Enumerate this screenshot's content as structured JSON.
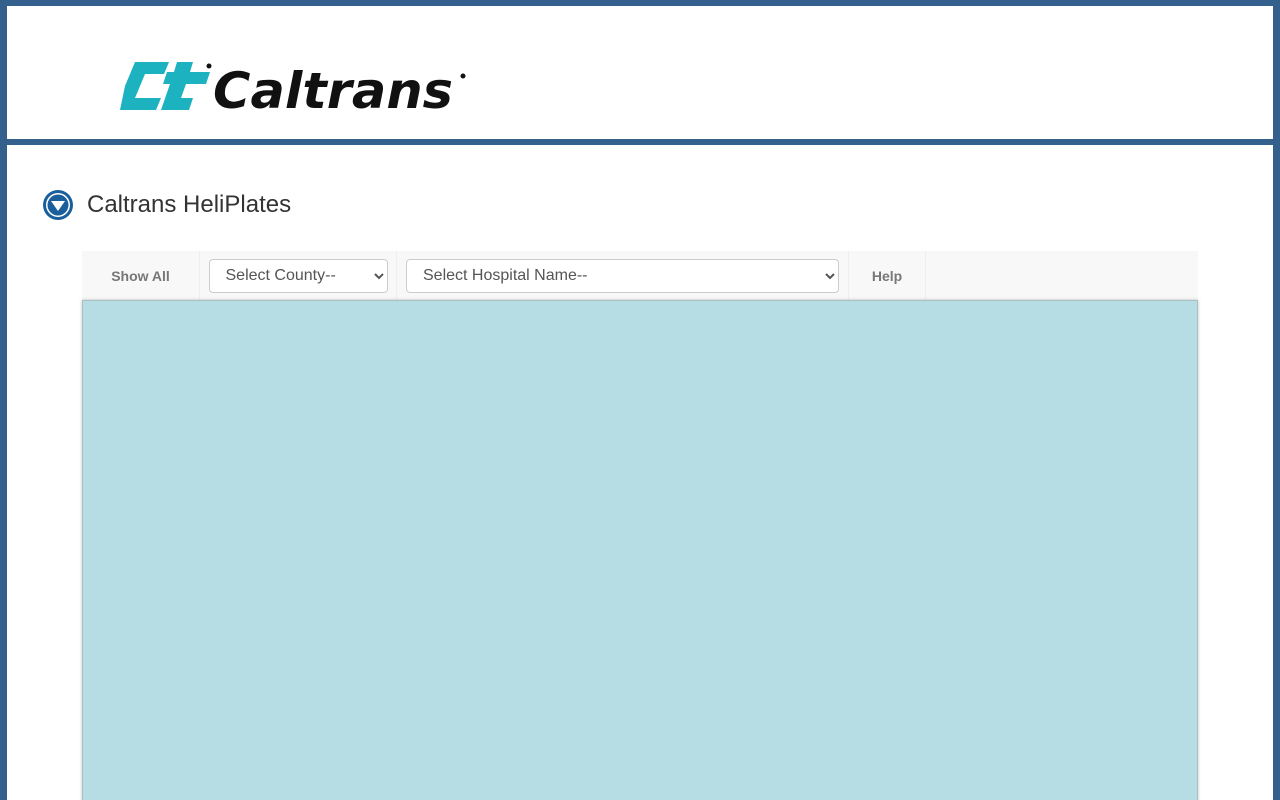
{
  "header": {
    "logo": {
      "icon": "caltrans-logo",
      "text": "Caltrans",
      "colors": {
        "mark": "#1cb2bf",
        "wordmark": "#111111"
      }
    }
  },
  "app": {
    "title": "Caltrans HeliPlates",
    "toggle_icon": "chevron-down-circle-icon"
  },
  "toolbar": {
    "show_all_label": "Show All",
    "county_select": {
      "selected": "Select County--",
      "options": [
        "Select County--"
      ]
    },
    "hospital_select": {
      "selected": "Select Hospital Name--",
      "options": [
        "Select Hospital Name--"
      ]
    },
    "help_label": "Help"
  },
  "colors": {
    "frame": "#33608c",
    "map_background": "#b6dde4",
    "toolbar_background": "#f8f8f8",
    "toggle_icon": "#1a5f9c"
  }
}
